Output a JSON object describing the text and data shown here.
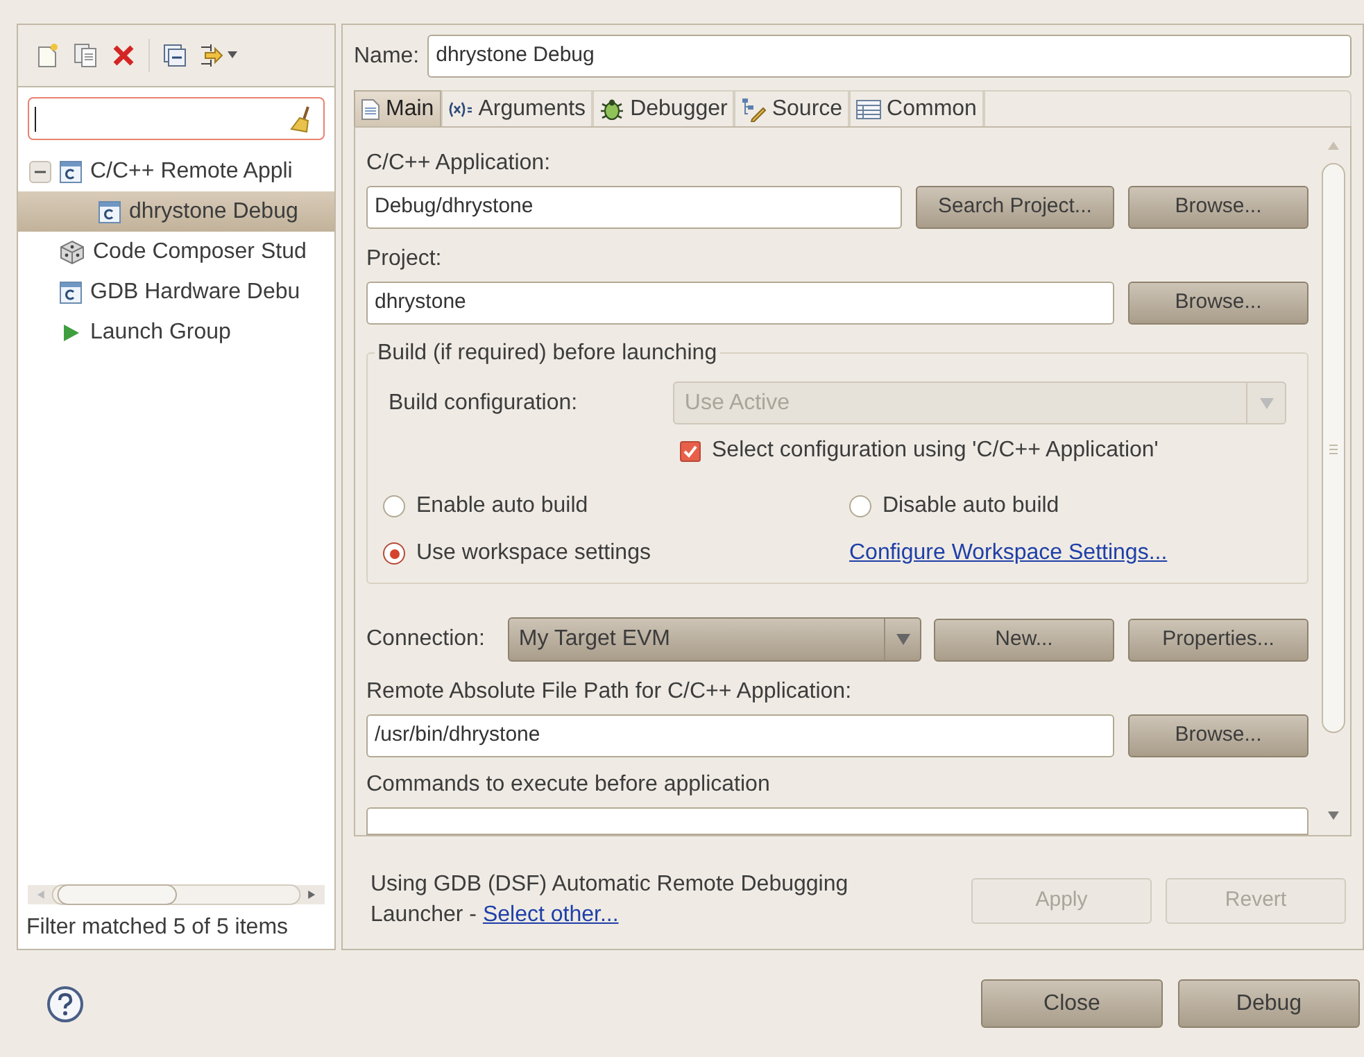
{
  "tree": [
    {
      "label": "C/C++ Remote Appli",
      "kind": "c-app",
      "expanded": true,
      "selected": false,
      "children": [
        {
          "label": "dhrystone Debug",
          "kind": "c-app",
          "selected": true
        }
      ]
    },
    {
      "label": "Code Composer Stud",
      "kind": "cube",
      "selected": false
    },
    {
      "label": "GDB Hardware Debu",
      "kind": "c-app",
      "selected": false
    },
    {
      "label": "Launch Group",
      "kind": "play",
      "selected": false
    }
  ],
  "filter_status": "Filter matched 5 of 5 items",
  "name": {
    "label": "Name:",
    "value": "dhrystone Debug"
  },
  "tabs": [
    {
      "label": "Main",
      "kind": "doc",
      "selected": true
    },
    {
      "label": "Arguments",
      "kind": "args",
      "selected": false
    },
    {
      "label": "Debugger",
      "kind": "bug",
      "selected": false
    },
    {
      "label": "Source",
      "kind": "source",
      "selected": false
    },
    {
      "label": "Common",
      "kind": "table",
      "selected": false
    }
  ],
  "main": {
    "application": {
      "label": "C/C++ Application:",
      "value": "Debug/dhrystone",
      "buttons": [
        "Search Project...",
        "Browse..."
      ]
    },
    "project": {
      "label": "Project:",
      "value": "dhrystone",
      "button": "Browse..."
    },
    "build": {
      "title": "Build (if required) before launching",
      "config_label": "Build configuration:",
      "config_value": "Use Active",
      "config_disabled": true,
      "checkbox": {
        "label": "Select configuration using 'C/C++ Application'",
        "checked": true
      },
      "radios": [
        {
          "label": "Enable auto build",
          "selected": false
        },
        {
          "label": "Disable auto build",
          "selected": false
        },
        {
          "label": "Use workspace settings",
          "selected": true
        }
      ],
      "link": "Configure Workspace Settings..."
    },
    "connection": {
      "label": "Connection:",
      "value": "My Target EVM",
      "buttons": [
        "New...",
        "Properties..."
      ]
    },
    "remote": {
      "label": "Remote Absolute File Path for C/C++ Application:",
      "value": "/usr/bin/dhrystone",
      "button": "Browse..."
    },
    "commands_label": "Commands to execute before application"
  },
  "launcher": {
    "text": "Using GDB (DSF) Automatic Remote Debugging Launcher - ",
    "link": "Select other..."
  },
  "actions": [
    {
      "label": "Apply",
      "disabled": true
    },
    {
      "label": "Revert",
      "disabled": true
    }
  ],
  "dialog_buttons": [
    "Close",
    "Debug"
  ]
}
